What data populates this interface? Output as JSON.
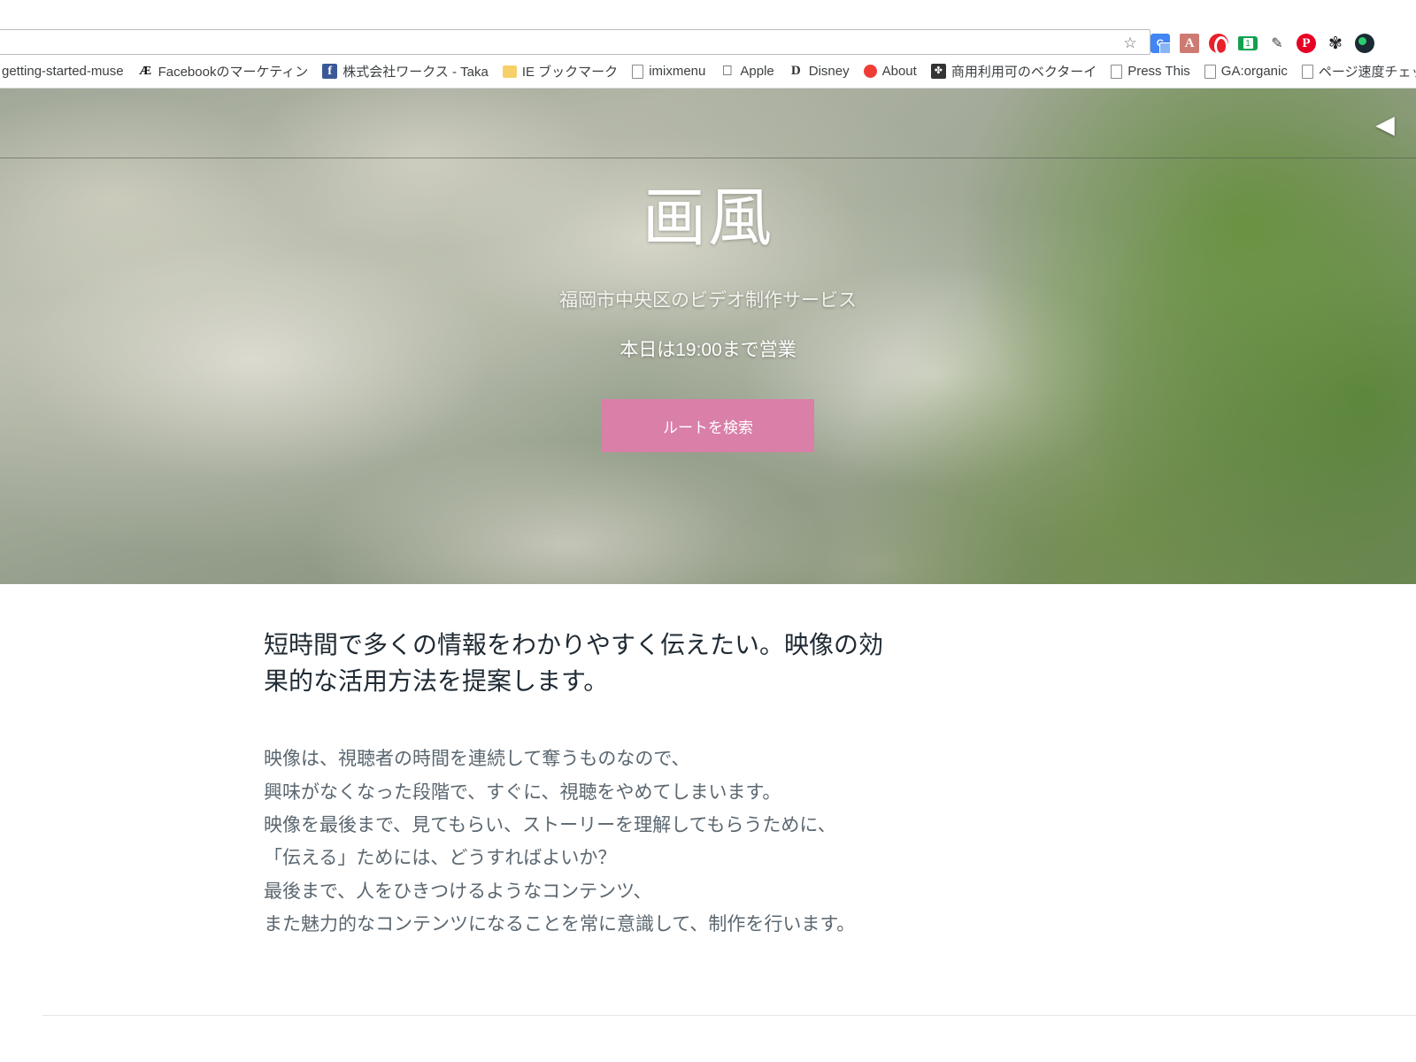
{
  "browser": {
    "omnibox": {
      "value": "",
      "placeholder": ""
    },
    "star_icon": "☆",
    "extensions": [
      {
        "name": "google-translate-extension",
        "glyph": "G"
      },
      {
        "name": "adobe-pdf-extension",
        "glyph": "⬇"
      },
      {
        "name": "opera-extension",
        "glyph": ""
      },
      {
        "name": "tag-counter-extension",
        "glyph": "1"
      },
      {
        "name": "sketch-extension",
        "glyph": "✎"
      },
      {
        "name": "pinterest-extension",
        "glyph": "P"
      },
      {
        "name": "settings-gear-extension",
        "glyph": "⚙"
      },
      {
        "name": "dark-circle-extension",
        "glyph": ""
      }
    ],
    "bookmarks": [
      {
        "label": "getting-started-muse",
        "icon": "none"
      },
      {
        "label": "Facebookのマーケティン",
        "icon": "ae-icon"
      },
      {
        "label": "株式会社ワークス - Taka",
        "icon": "facebook-icon"
      },
      {
        "label": "IE ブックマーク",
        "icon": "folder-icon"
      },
      {
        "label": "imixmenu",
        "icon": "document-icon"
      },
      {
        "label": "Apple",
        "icon": "apple-icon"
      },
      {
        "label": "Disney",
        "icon": "disney-icon"
      },
      {
        "label": "About",
        "icon": "about-icon"
      },
      {
        "label": "商用利用可のベクターイ",
        "icon": "vector-icon"
      },
      {
        "label": "Press This",
        "icon": "document-icon"
      },
      {
        "label": "GA:organic",
        "icon": "document-icon"
      },
      {
        "label": "ページ速度チェックブック",
        "icon": "document-icon"
      }
    ]
  },
  "hero": {
    "title": "画風",
    "subtitle": "福岡市中央区のビデオ制作サービス",
    "hours": "本日は19:00まで営業",
    "cta_label": "ルートを検索",
    "cta_color": "#d97fa8",
    "carousel_prev_glyph": "◀"
  },
  "content": {
    "lead": "短時間で多くの情報をわかりやすく伝えたい。映像の効果的な活用方法を提案します。",
    "paragraph_lines": [
      "映像は、視聴者の時間を連続して奪うものなので、",
      "興味がなくなった段階で、すぐに、視聴をやめてしまいます。",
      "映像を最後まで、見てもらい、ストーリーを理解してもらうために、",
      "「伝える」ためには、どうすればよいか？",
      "最後まで、人をひきつけるようなコンテンツ、",
      "また魅力的なコンテンツになることを常に意識して、制作を行います。"
    ]
  }
}
